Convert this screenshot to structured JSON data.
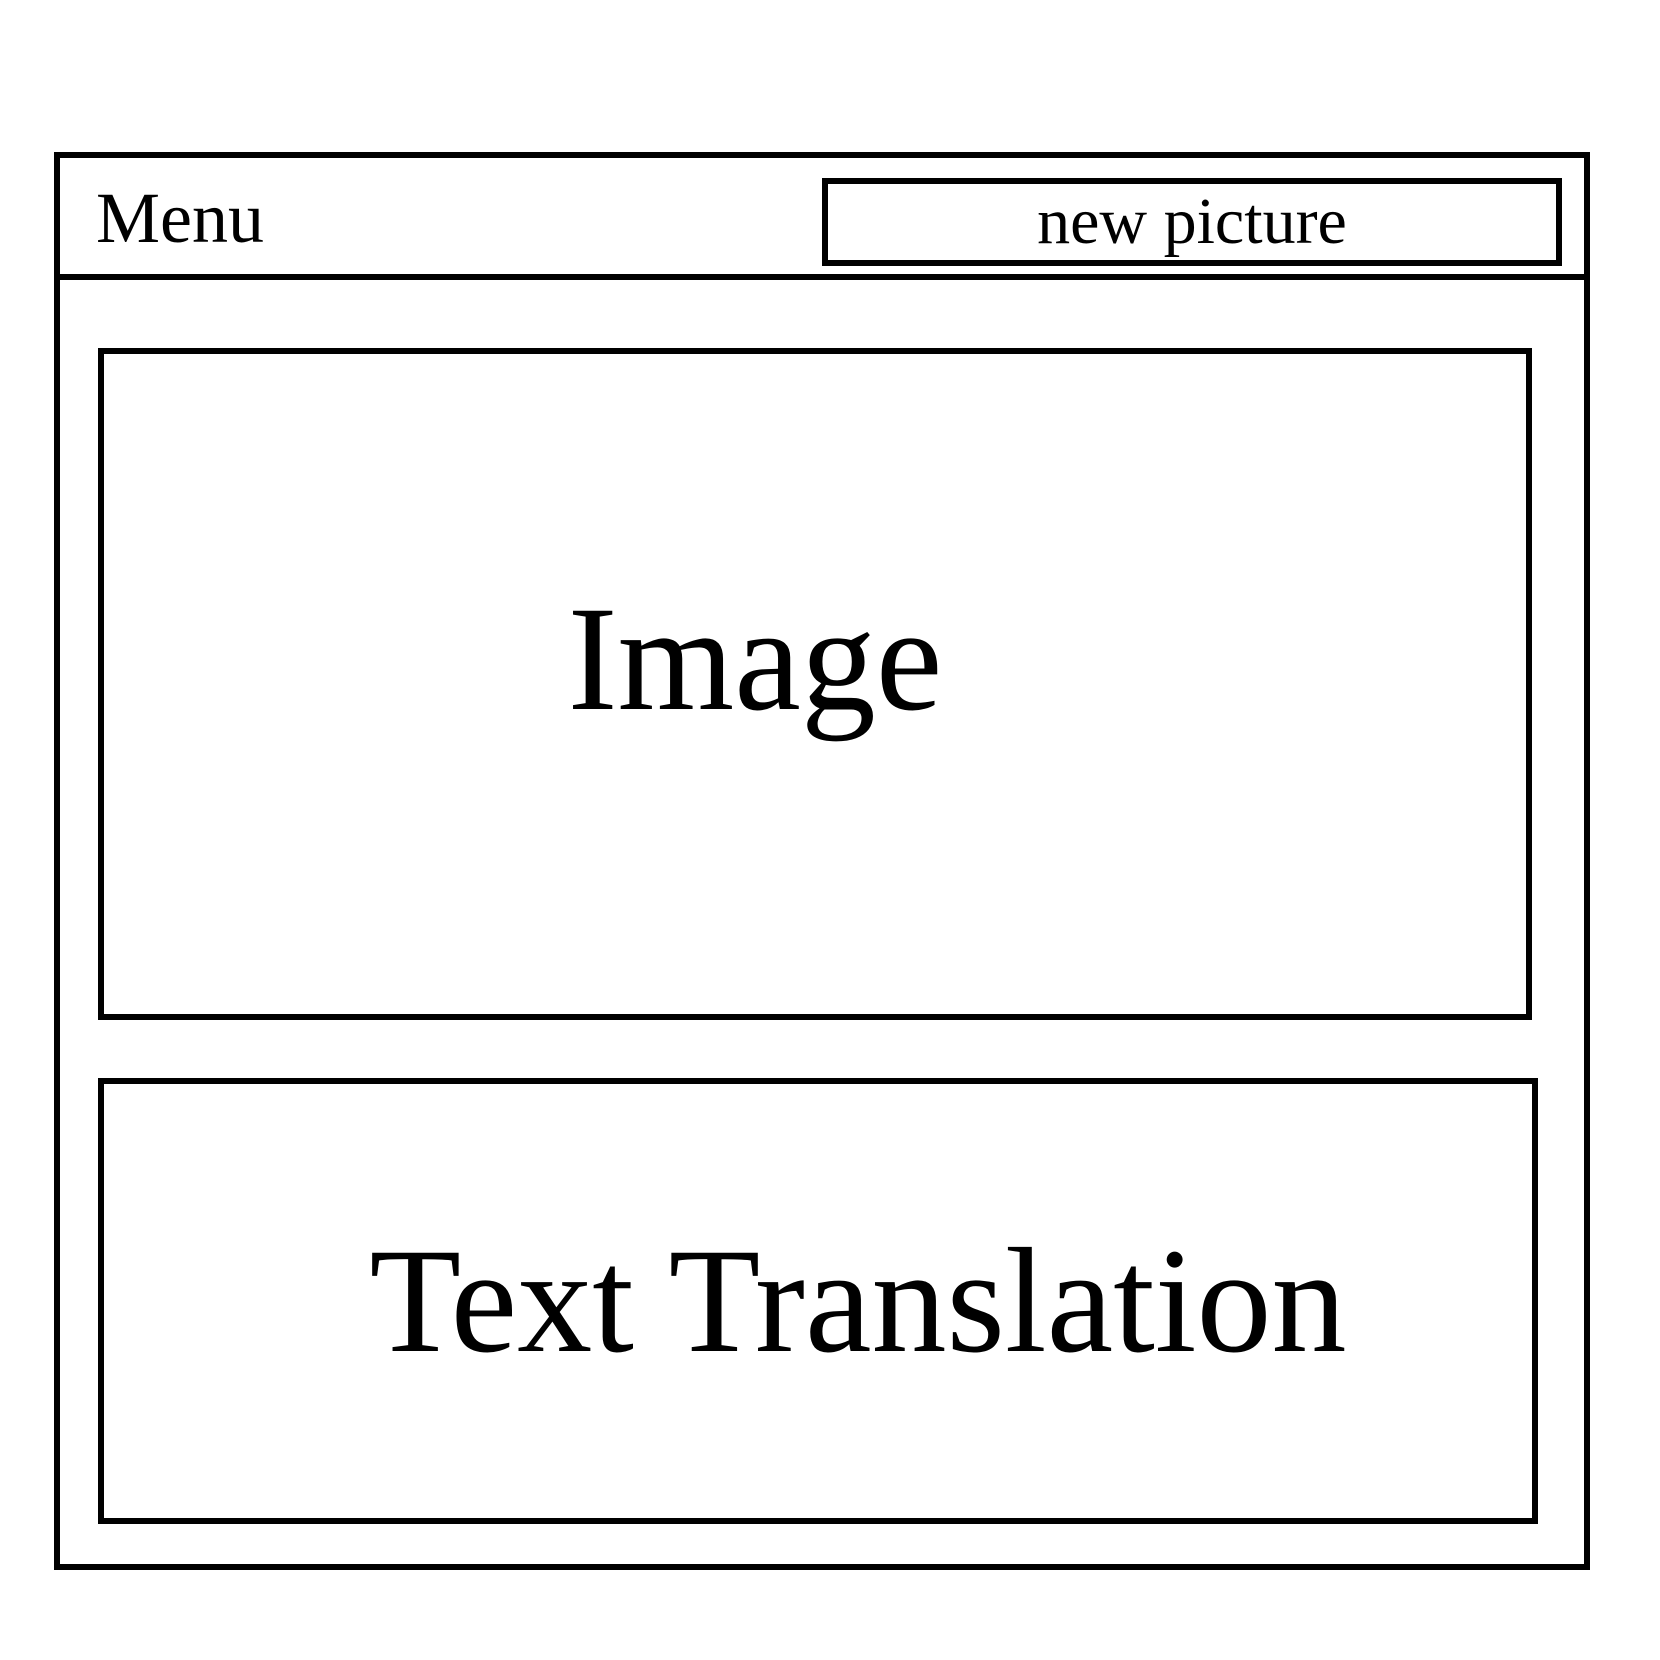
{
  "header": {
    "menu_label": "Menu",
    "new_picture_label": "new picture"
  },
  "main": {
    "image_panel_label": "Image",
    "translation_panel_label": "Text Translation"
  }
}
